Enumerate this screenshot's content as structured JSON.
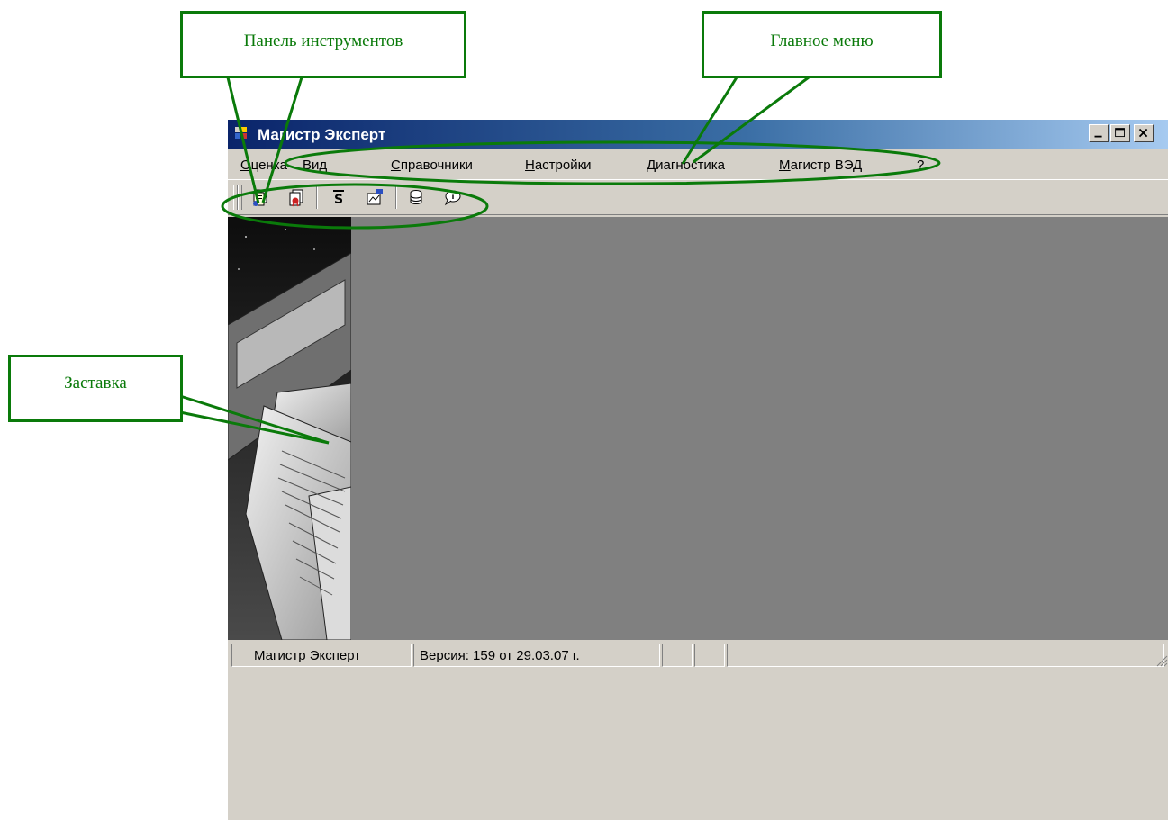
{
  "window": {
    "title": "Магистр Эксперт",
    "controls": [
      "minimize",
      "maximize",
      "close"
    ]
  },
  "menu": {
    "items": [
      "Оценка",
      "Вид",
      "Справочники",
      "Настройки",
      "Диагностика",
      "Магистр ВЭД",
      "?"
    ]
  },
  "toolbar": {
    "icons": [
      "document-icon",
      "document-seal-icon",
      "sum-icon",
      "chart-icon",
      "database-icon",
      "info-bubble-icon"
    ]
  },
  "statusbar": {
    "app_name": "Магистр Эксперт",
    "version": "Версия: 159 от 29.03.07 г."
  },
  "annotations": {
    "toolbar_label": "Панель инструментов",
    "main_menu_label": "Главное меню",
    "splash_label": "Заставка",
    "color": "#0a7a0a"
  }
}
